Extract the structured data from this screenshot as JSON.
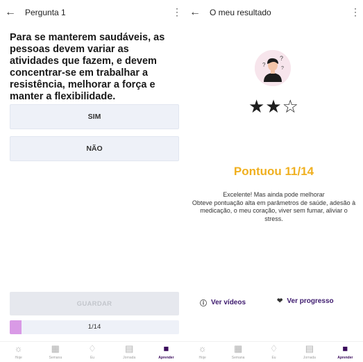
{
  "left": {
    "title": "Pergunta 1",
    "question": "Para se manterem saudáveis, as pessoas devem variar as atividades que fazem, e devem concentrar-se em trabalhar a resistência, melhorar a força e manter a flexibilidade.",
    "answers": [
      "SIM",
      "NÃO"
    ],
    "save_label": "GUARDAR",
    "progress_text": "1/14",
    "progress_fraction": 0.0714
  },
  "right": {
    "title": "O meu resultado",
    "stars": "★★☆",
    "rating": {
      "filled": 2,
      "total": 3
    },
    "score": "Pontuou 11/14",
    "feedback": "Excelente! Mas ainda pode melhorar\nObteve pontuação alta em parâmetros de saúde, adesão à medicação, o meu coração, viver sem fumar, aliviar o stress.",
    "actions": {
      "videos_label": "Ver vídeos",
      "progress_label": "Ver progresso"
    }
  },
  "nav": [
    "Hoje",
    "Semana",
    "Eu",
    "Jornada",
    "Aprender"
  ],
  "nav_active": "Aprender",
  "colors": {
    "accent_purple": "#3b0b5c",
    "score_yellow": "#f0b020",
    "progress_fill": "#d99ae6"
  }
}
